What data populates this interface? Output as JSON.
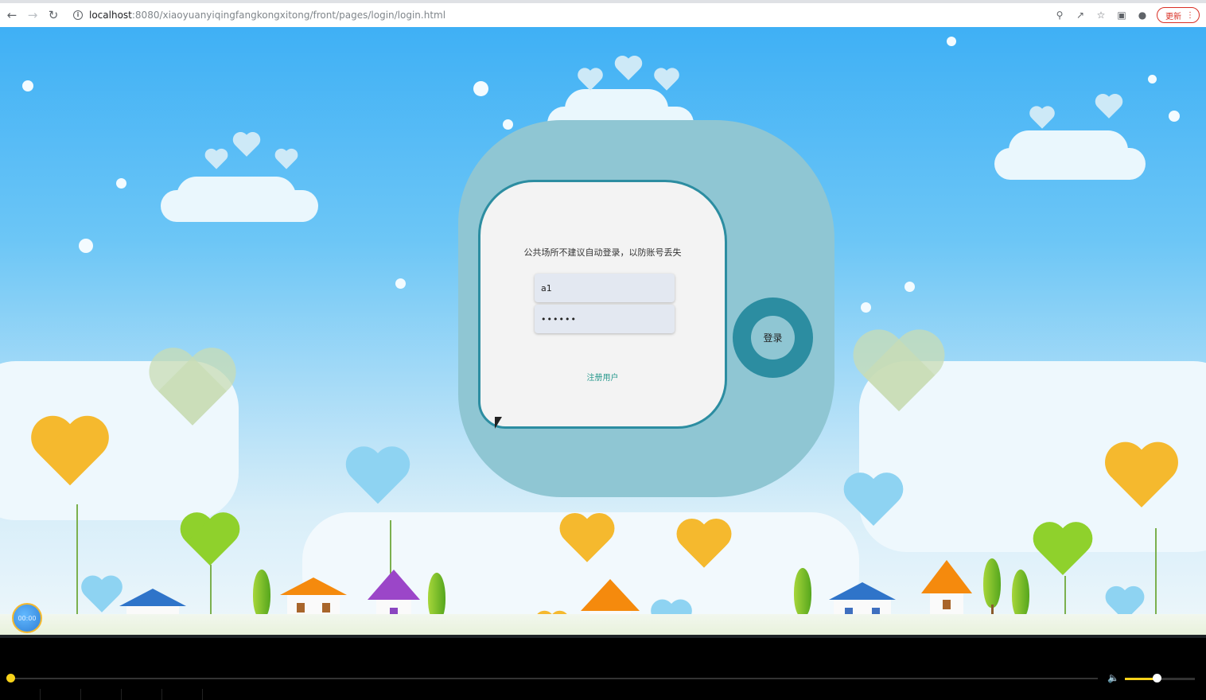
{
  "browser": {
    "url_host": "localhost",
    "url_path": ":8080/xiaoyuanyiqingfangkongxitong/front/pages/login/login.html",
    "update_label": "更新"
  },
  "login": {
    "tip": "公共场所不建议自动登录，以防账号丢失",
    "username_value": "a1",
    "password_value": "••••••",
    "register_label": "注册用户",
    "login_button_label": "登录"
  },
  "badge": {
    "label": "00:00"
  },
  "player": {
    "progress": 0.0,
    "volume": 0.45
  },
  "colors": {
    "panel_outer": "#8fc6d3",
    "panel_border": "#2c8da1",
    "player_accent": "#f7d21a"
  }
}
